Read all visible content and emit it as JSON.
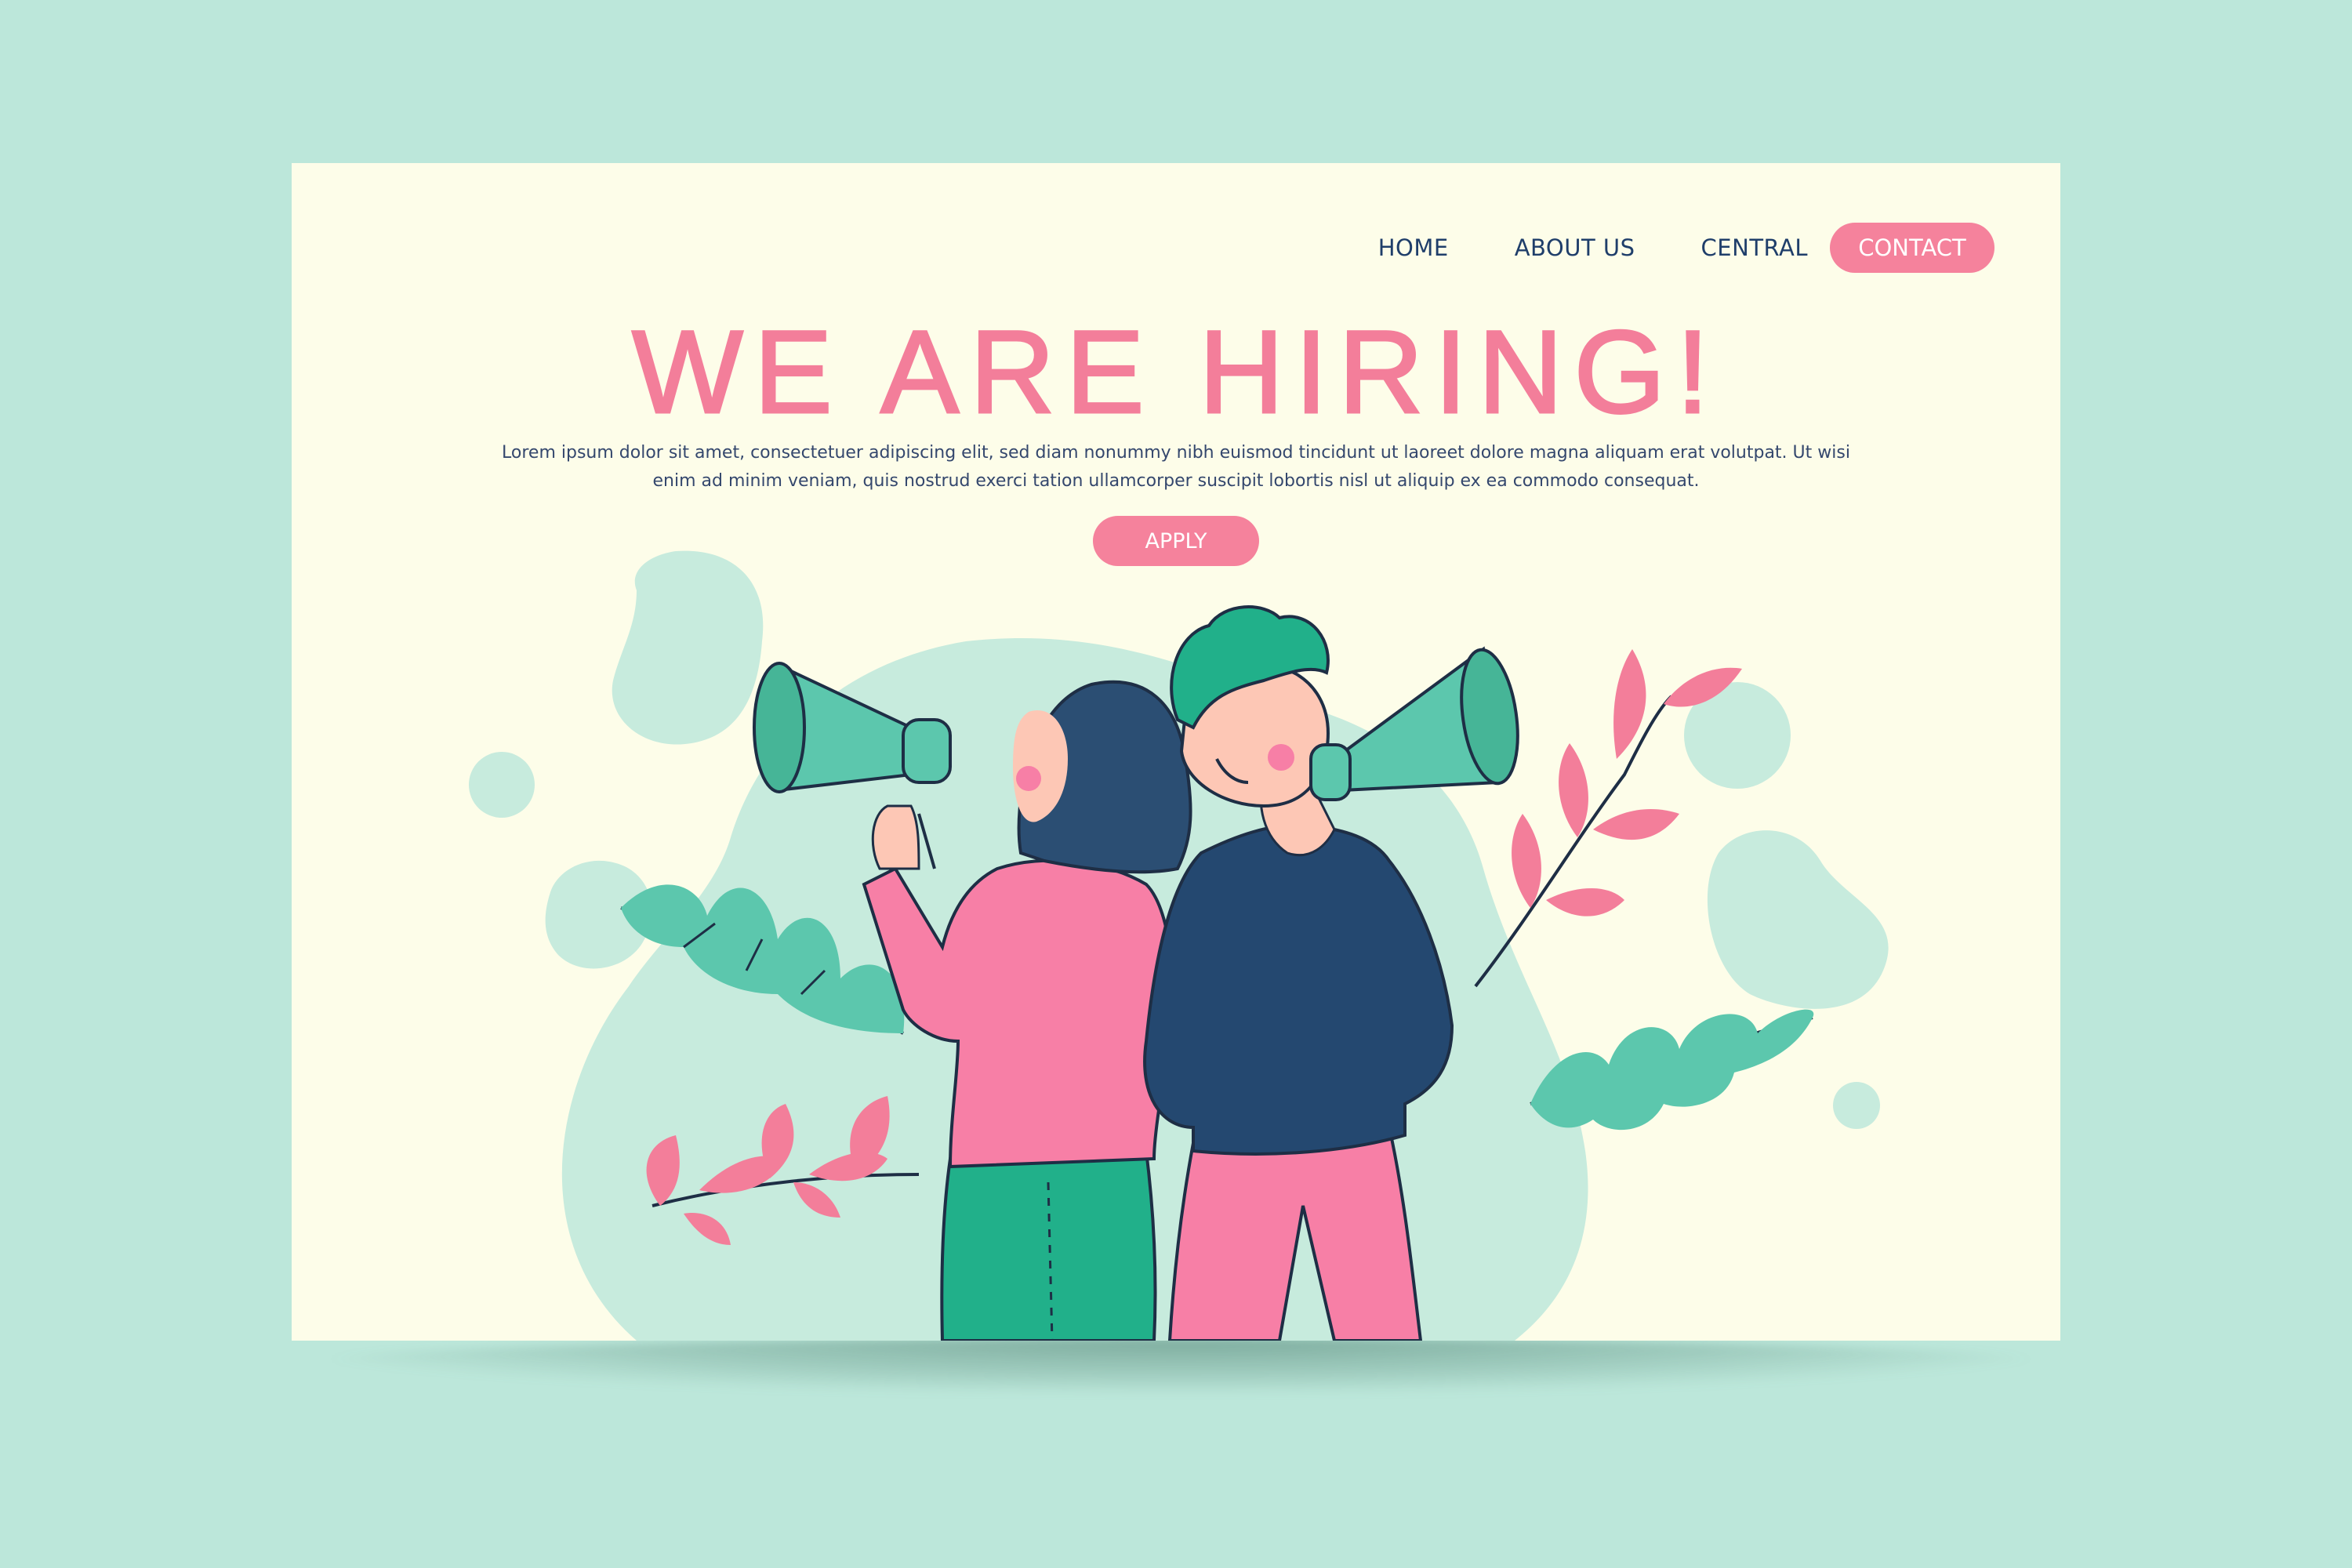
{
  "nav": {
    "items": [
      {
        "label": "HOME"
      },
      {
        "label": "ABOUT US"
      },
      {
        "label": "CENTRAL"
      }
    ],
    "contact_label": "CONTACT"
  },
  "hero": {
    "title": "WE ARE HIRING!",
    "body": "Lorem ipsum dolor sit amet, consectetuer adipiscing elit, sed diam nonummy nibh euismod tincidunt ut laoreet dolore magna aliquam erat volutpat. Ut wisi enim ad minim veniam, quis nostrud exerci tation ullamcorper suscipit lobortis nisl ut aliquip ex ea commodo consequat.",
    "apply_label": "APPLY"
  },
  "colors": {
    "background": "#bce7da",
    "page": "#fdfde9",
    "accent_pink": "#f5829c",
    "navy": "#1f3e6a",
    "teal": "#5cc7ad"
  }
}
